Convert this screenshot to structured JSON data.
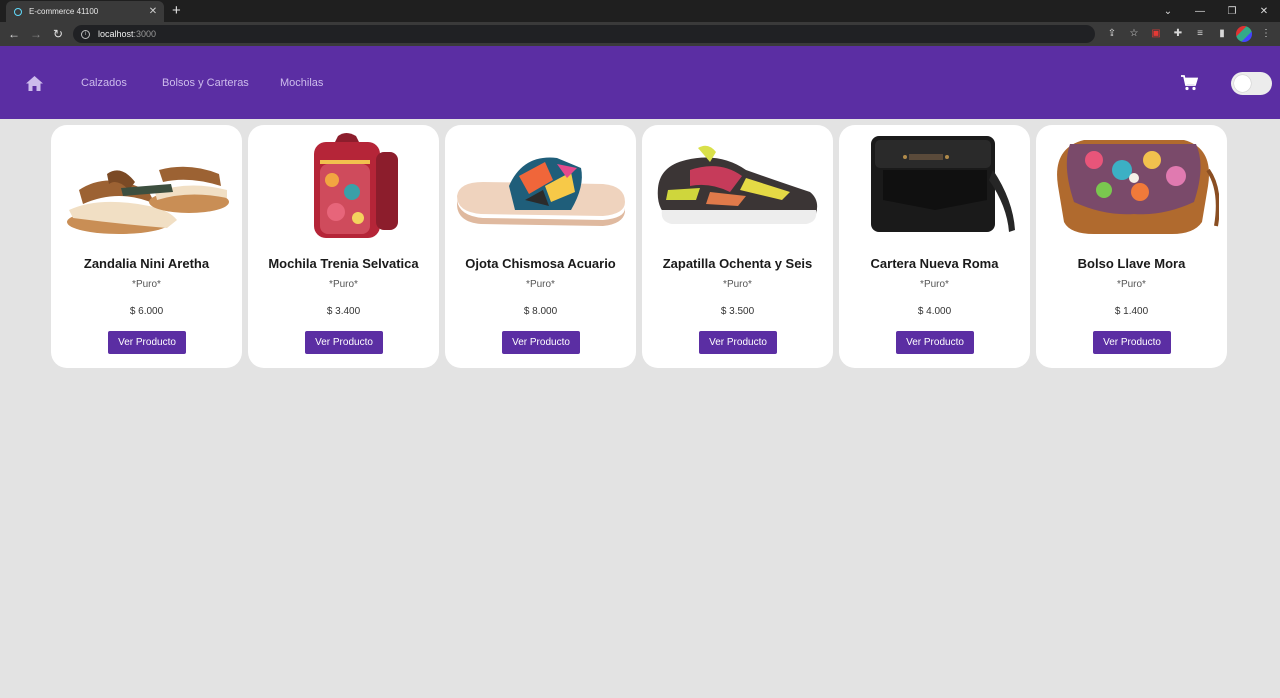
{
  "browser": {
    "tab_title": "E-commerce 41100",
    "tab_close": "✕",
    "new_tab": "+",
    "url_host": "localhost",
    "url_port": ":3000",
    "window_controls": [
      "⌄",
      "—",
      "❐",
      "✕"
    ]
  },
  "nav": {
    "links": [
      "Calzados",
      "Bolsos y Carteras",
      "Mochilas"
    ],
    "icons": [
      "home-icon",
      "cart-icon"
    ],
    "theme_toggle_on": false,
    "accent_color": "#5b2ea3",
    "link_color": "#cdbcec"
  },
  "products": [
    {
      "title": "Zandalia Nini Aretha",
      "brand": "*Puro*",
      "price": "$ 6.000",
      "button": "Ver Producto",
      "image": "sandal"
    },
    {
      "title": "Mochila Trenia Selvatica",
      "brand": "*Puro*",
      "price": "$ 3.400",
      "button": "Ver Producto",
      "image": "backpack"
    },
    {
      "title": "Ojota Chismosa Acuario",
      "brand": "*Puro*",
      "price": "$ 8.000",
      "button": "Ver Producto",
      "image": "slide"
    },
    {
      "title": "Zapatilla Ochenta y Seis",
      "brand": "*Puro*",
      "price": "$ 3.500",
      "button": "Ver Producto",
      "image": "sneaker"
    },
    {
      "title": "Cartera Nueva Roma",
      "brand": "*Puro*",
      "price": "$ 4.000",
      "button": "Ver Producto",
      "image": "messenger-bag"
    },
    {
      "title": "Bolso Llave Mora",
      "brand": "*Puro*",
      "price": "$ 1.400",
      "button": "Ver Producto",
      "image": "floral-bag"
    }
  ]
}
